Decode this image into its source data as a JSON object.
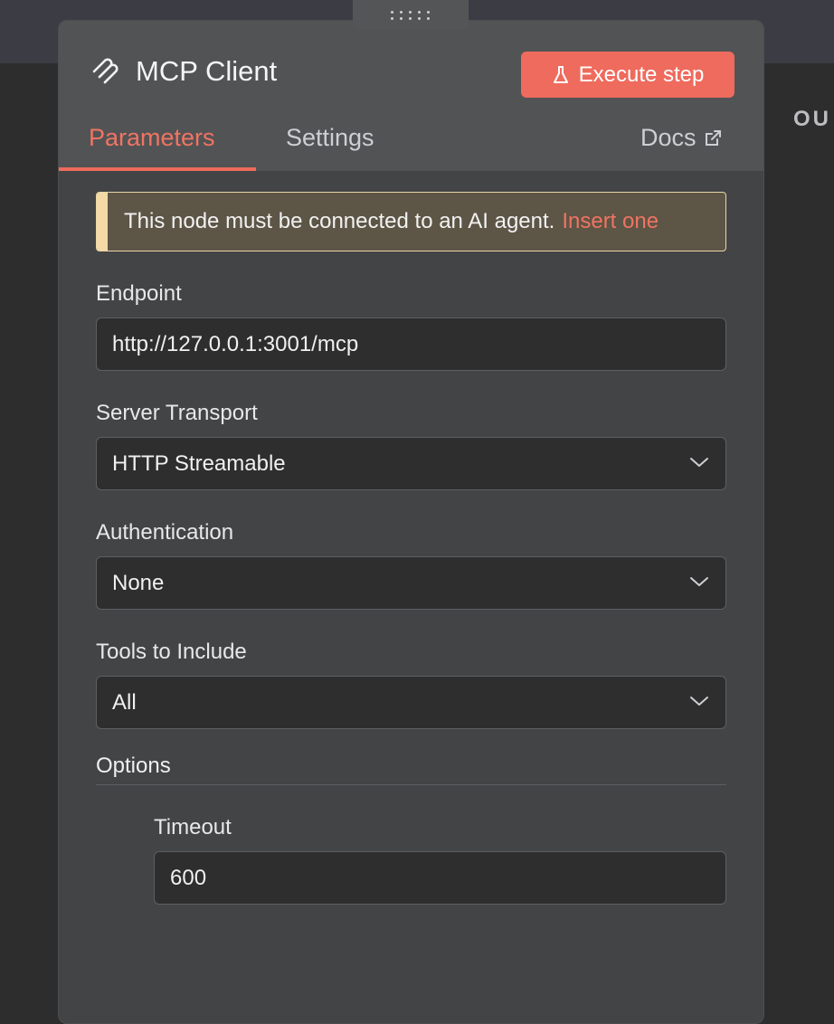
{
  "background": {
    "output_label": "OU"
  },
  "panel": {
    "title": "MCP Client",
    "node_icon": "mcp-icon",
    "execute_label": "Execute step",
    "execute_icon": "flask-icon",
    "tabs": [
      {
        "label": "Parameters",
        "active": true
      },
      {
        "label": "Settings",
        "active": false
      }
    ],
    "docs_label": "Docs",
    "docs_icon": "external-link-icon",
    "accent_color": "#ee6b5d"
  },
  "notice": {
    "text": "This node must be connected to an AI agent.",
    "link": "Insert one"
  },
  "fields": {
    "endpoint": {
      "label": "Endpoint",
      "value": "http://127.0.0.1:3001/mcp"
    },
    "server_transport": {
      "label": "Server Transport",
      "value": "HTTP Streamable"
    },
    "authentication": {
      "label": "Authentication",
      "value": "None"
    },
    "tools_to_include": {
      "label": "Tools to Include",
      "value": "All"
    }
  },
  "options": {
    "title": "Options",
    "timeout": {
      "label": "Timeout",
      "value": "600"
    }
  }
}
